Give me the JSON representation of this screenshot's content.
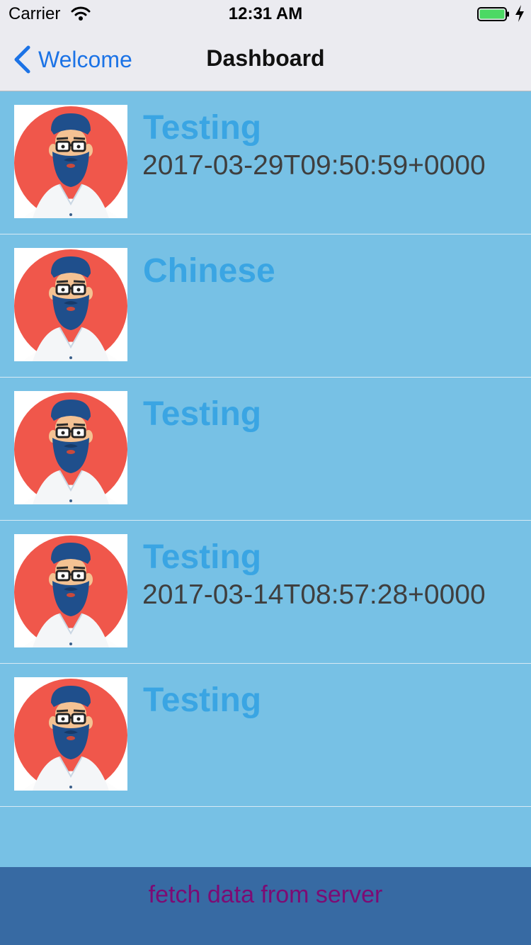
{
  "status_bar": {
    "carrier": "Carrier",
    "time": "12:31 AM",
    "battery_color": "#4cd964"
  },
  "nav": {
    "back_label": "Welcome",
    "title": "Dashboard",
    "tint_color": "#1c73e6"
  },
  "rows": [
    {
      "title": "Testing",
      "subtitle": "2017-03-29T09:50:59+0000"
    },
    {
      "title": "Chinese",
      "subtitle": ""
    },
    {
      "title": "Testing",
      "subtitle": ""
    },
    {
      "title": "Testing",
      "subtitle": "2017-03-14T08:57:28+0000"
    },
    {
      "title": "Testing",
      "subtitle": ""
    }
  ],
  "footer": {
    "button_label": "fetch data from server"
  },
  "colors": {
    "list_background": "#77c1e5",
    "row_title": "#3aa5e3",
    "footer_background": "#376aa3",
    "footer_text": "#7d0b74"
  },
  "icons": {
    "avatar": "bearded-man-avatar-icon"
  }
}
